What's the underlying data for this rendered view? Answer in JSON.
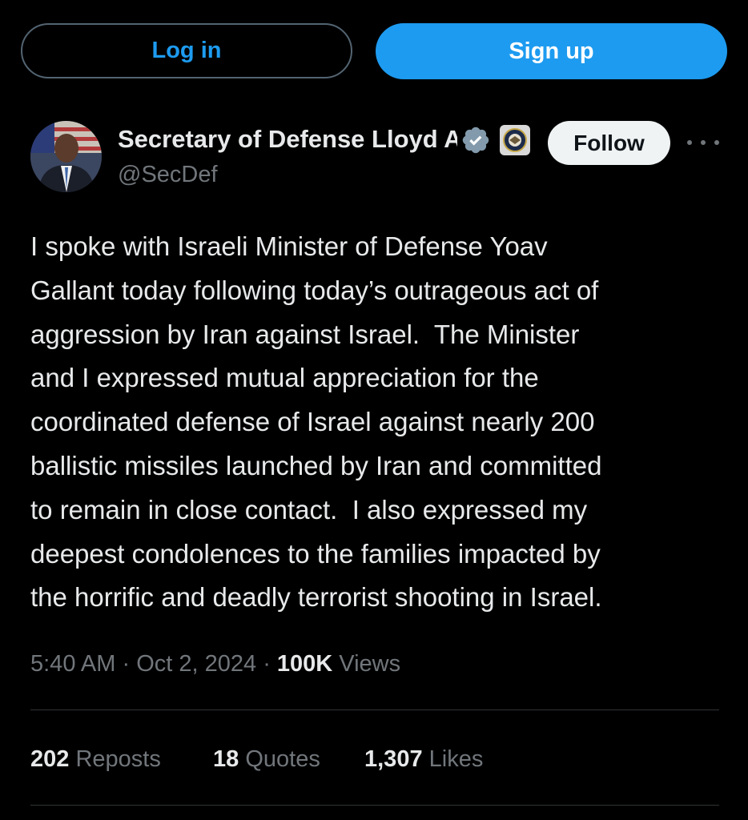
{
  "header": {
    "login_label": "Log in",
    "signup_label": "Sign up"
  },
  "author": {
    "display_name": "Secretary of Defense Lloyd Austin",
    "handle": "@SecDef",
    "follow_label": "Follow"
  },
  "tweet": {
    "text": "I spoke with Israeli Minister of Defense Yoav\nGallant today following today’s outrageous act of\naggression by Iran against Israel.  The Minister\nand I expressed mutual appreciation for the\ncoordinated defense of Israel against nearly 200\nballistic missiles launched by Iran and committed\nto remain in close contact.  I also expressed my\ndeepest condolences to the families impacted by\nthe horrific and deadly terrorist shooting in Israel.",
    "time": "5:40 AM",
    "date": "Oct 2, 2024",
    "views_count": "100K",
    "views_label": "Views"
  },
  "stats": {
    "reposts_count": "202",
    "reposts_label": "Reposts",
    "quotes_count": "18",
    "quotes_label": "Quotes",
    "likes_count": "1,307",
    "likes_label": "Likes"
  },
  "icons": {
    "verified": "verified-badge-icon",
    "affiliate": "dod-seal-icon",
    "more": "more-options-icon"
  },
  "colors": {
    "background": "#000000",
    "accent": "#1d9bf0",
    "text_primary": "#e7e9ea",
    "text_secondary": "#71767b",
    "divider": "#2f3336",
    "verified_badge": "#829aab"
  }
}
